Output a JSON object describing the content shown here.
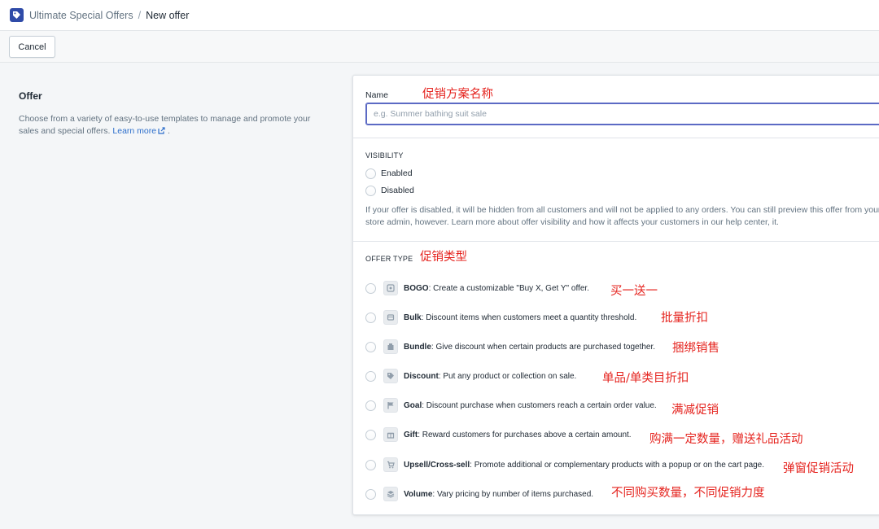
{
  "header": {
    "app_name": "Ultimate Special Offers",
    "separator": "/",
    "page_name": "New offer"
  },
  "actions": {
    "cancel_label": "Cancel"
  },
  "offer_section": {
    "title": "Offer",
    "description": "Choose from a variety of easy-to-use templates to manage and promote your sales and special offers.",
    "learn_more": "Learn more",
    "trailing": "."
  },
  "form": {
    "name_label": "Name",
    "name_placeholder": "e.g. Summer bathing suit sale",
    "name_value": "",
    "visibility_heading": "VISIBILITY",
    "visibility_options": [
      {
        "label": "Enabled",
        "selected": false
      },
      {
        "label": "Disabled",
        "selected": false
      }
    ],
    "visibility_help": "If your offer is disabled, it will be hidden from all customers and will not be applied to any orders. You can still preview this offer from your store admin, however. Learn more about offer visibility and how it affects your customers in our help center, it.",
    "offer_type_heading": "OFFER TYPE",
    "offer_types": [
      {
        "name": "BOGO",
        "desc": ": Create a customizable \"Buy X, Get Y\" offer.",
        "icon": "bogo-icon"
      },
      {
        "name": "Bulk",
        "desc": ": Discount items when customers meet a quantity threshold.",
        "icon": "bulk-icon"
      },
      {
        "name": "Bundle",
        "desc": ": Give discount when certain products are purchased together.",
        "icon": "bundle-icon"
      },
      {
        "name": "Discount",
        "desc": ": Put any product or collection on sale.",
        "icon": "tag-icon"
      },
      {
        "name": "Goal",
        "desc": ": Discount purchase when customers reach a certain order value.",
        "icon": "flag-icon"
      },
      {
        "name": "Gift",
        "desc": ": Reward customers for purchases above a certain amount.",
        "icon": "gift-icon"
      },
      {
        "name": "Upsell/Cross-sell",
        "desc": ": Promote additional or complementary products with a popup or on the cart page.",
        "icon": "cart-icon"
      },
      {
        "name": "Volume",
        "desc": ": Vary pricing by number of items purchased.",
        "icon": "stack-icon"
      }
    ]
  },
  "annotations": {
    "name": "促销方案名称",
    "offer_type": "促销类型",
    "bogo": "买一送一",
    "bulk": "批量折扣",
    "bundle": "捆绑销售",
    "discount": "单品/单类目折扣",
    "goal": "满减促销",
    "gift": "购满一定数量，赠送礼品活动",
    "upsell": "弹窗促销活动",
    "volume": "不同购买数量，不同促销力度"
  },
  "colors": {
    "accent": "#5c6ac4",
    "logo": "#2f4ba8",
    "link": "#2c6ecb",
    "annotation": "#e5231e"
  }
}
